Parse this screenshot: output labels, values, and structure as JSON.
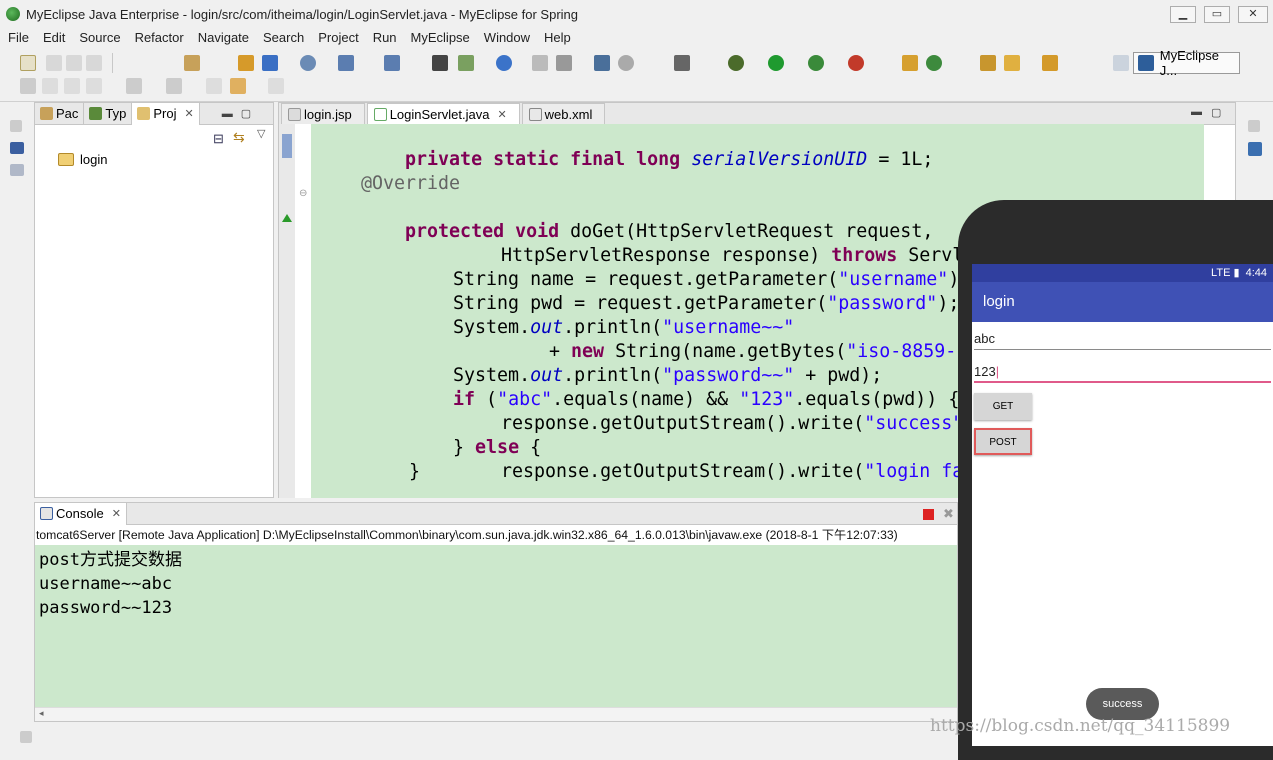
{
  "window": {
    "title": "MyEclipse Java Enterprise - login/src/com/itheima/login/LoginServlet.java - MyEclipse for Spring",
    "minimize": "▁",
    "maximize": "▭",
    "close": "✕"
  },
  "menu": [
    "File",
    "Edit",
    "Source",
    "Refactor",
    "Navigate",
    "Search",
    "Project",
    "Run",
    "MyEclipse",
    "Window",
    "Help"
  ],
  "perspective": {
    "label": "MyEclipse J..."
  },
  "explorer": {
    "tabs": [
      {
        "label": "Pac",
        "icon": "package-icon"
      },
      {
        "label": "Typ",
        "icon": "type-hierarchy-icon"
      },
      {
        "label": "Proj",
        "icon": "project-icon"
      }
    ],
    "tree": [
      {
        "label": "login",
        "icon": "project-folder-icon"
      }
    ]
  },
  "editor": {
    "tabs": [
      {
        "label": "login.jsp",
        "icon": "jsp-file-icon"
      },
      {
        "label": "LoginServlet.java",
        "icon": "java-file-icon"
      },
      {
        "label": "web.xml",
        "icon": "xml-file-icon"
      }
    ],
    "code": {
      "l1": {
        "k": "private static final long ",
        "i": "serialVersionUID",
        "r": " = 1L;"
      },
      "l2": "@Override",
      "l3": {
        "k": "protected void ",
        "r": "doGet(HttpServletRequest request,"
      },
      "l4": {
        "a": "HttpServletResponse response) ",
        "k": "throws",
        "r": " Servl"
      },
      "l5": {
        "a": "String name = request.getParameter(",
        "s": "\"username\"",
        "r": ")"
      },
      "l6": {
        "a": "String pwd = request.getParameter(",
        "s": "\"password\"",
        "r": ");"
      },
      "l7": {
        "a": "System.",
        "i": "out",
        "b": ".println(",
        "s": "\"username~~\""
      },
      "l8": {
        "a": "+ ",
        "k": "new",
        "b": " String(name.getBytes(",
        "s": "\"iso-8859-1"
      },
      "l9": {
        "a": "System.",
        "i": "out",
        "b": ".println(",
        "s": "\"password~~\"",
        "r": " + pwd);"
      },
      "l10": {
        "k": "if",
        "a": " (",
        "s1": "\"abc\"",
        "b": ".equals(name) && ",
        "s2": "\"123\"",
        "r": ".equals(pwd)) {"
      },
      "l11": {
        "a": "response.getOutputStream().write(",
        "s": "\"success\""
      },
      "l12": {
        "a": "} ",
        "k": "else",
        "r": " {"
      },
      "l13": {
        "a": "response.getOutputStream().write(",
        "s": "\"login fa"
      },
      "l14": "}"
    }
  },
  "console": {
    "tab_label": "Console",
    "description": "tomcat6Server [Remote Java Application] D:\\MyEclipseInstall\\Common\\binary\\com.sun.java.jdk.win32.x86_64_1.6.0.013\\bin\\javaw.exe (2018-8-1 下午12:07:33)",
    "lines": [
      "post方式提交数据",
      "username~~abc",
      "password~~123"
    ]
  },
  "phone": {
    "time": "4:44",
    "status_icons": "LTE ▮",
    "app_title": "login",
    "username_value": "abc",
    "password_value": "123",
    "get_label": "GET",
    "post_label": "POST",
    "toast": "success",
    "accent_color": "#3f51b5",
    "status_color": "#303f9f"
  },
  "watermark": "https://blog.csdn.net/qq_34115899"
}
